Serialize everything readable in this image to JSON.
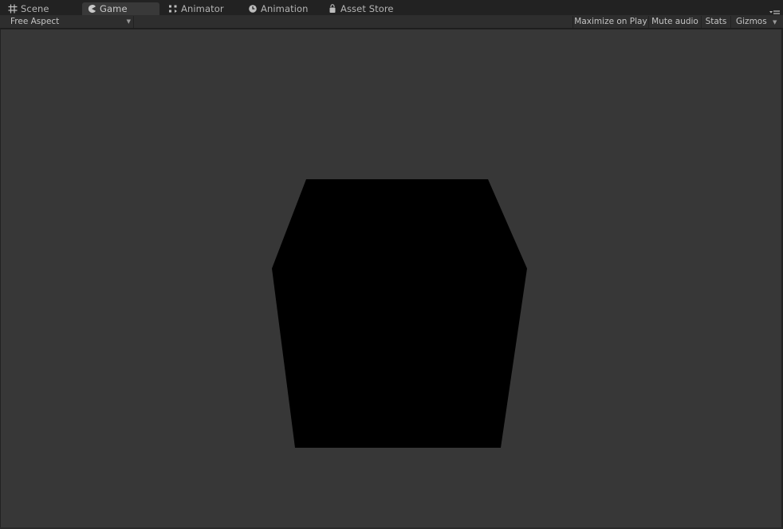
{
  "tabs": [
    {
      "label": "Scene",
      "icon": "grid-icon",
      "active": false
    },
    {
      "label": "Game",
      "icon": "pacman-icon",
      "active": true
    },
    {
      "label": "Animator",
      "icon": "nodes-icon",
      "active": false
    },
    {
      "label": "Animation",
      "icon": "clock-icon",
      "active": false
    },
    {
      "label": "Asset Store",
      "icon": "bag-icon",
      "active": false
    }
  ],
  "toolbar": {
    "aspect_label": "Free Aspect",
    "maximize_label": "Maximize on Play",
    "mute_label": "Mute audio",
    "stats_label": "Stats",
    "gizmos_label": "Gizmos"
  },
  "colors": {
    "tab_bg": "#222222",
    "active_tab_bg": "#393939",
    "toolbar_bg": "#2e2e2e",
    "viewport_bg": "#373737",
    "shape_fill": "#000000",
    "text": "#c4c4c4"
  }
}
